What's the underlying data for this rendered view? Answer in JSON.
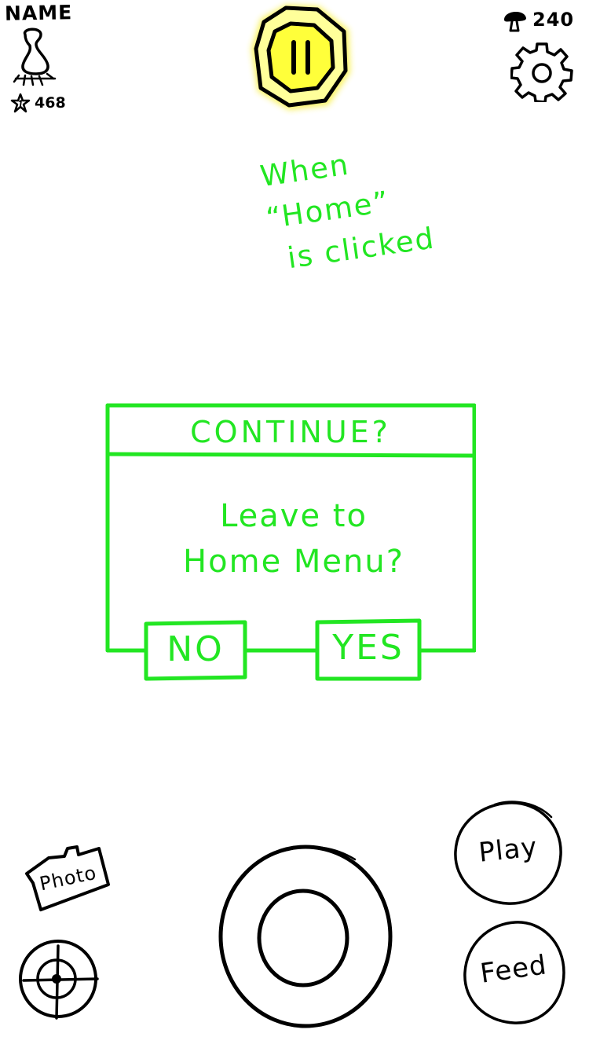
{
  "hud": {
    "player_name": "NAME",
    "star_count": "468",
    "mushroom_count": "240",
    "icons": {
      "avatar": "pet-avatar-icon",
      "star": "star-icon",
      "mushroom": "mushroom-icon",
      "settings": "gear-icon",
      "pause": "pause-icon"
    }
  },
  "annotation": {
    "line1": "When “Home”",
    "line2": "is clicked"
  },
  "dialog": {
    "title": "CONTINUE?",
    "message_line1": "Leave to",
    "message_line2": "Home Menu?",
    "no_label": "NO",
    "yes_label": "YES",
    "color": "#22e622"
  },
  "controls": {
    "photo_label": "Photo",
    "play_label": "Play",
    "feed_label": "Feed",
    "icons": {
      "photo": "camera-icon",
      "crosshair": "crosshair-icon",
      "joystick": "joystick-icon"
    }
  },
  "colors": {
    "pause_glow": "#f7ee2a",
    "ink": "#000000",
    "wireframe_green": "#22e622"
  }
}
